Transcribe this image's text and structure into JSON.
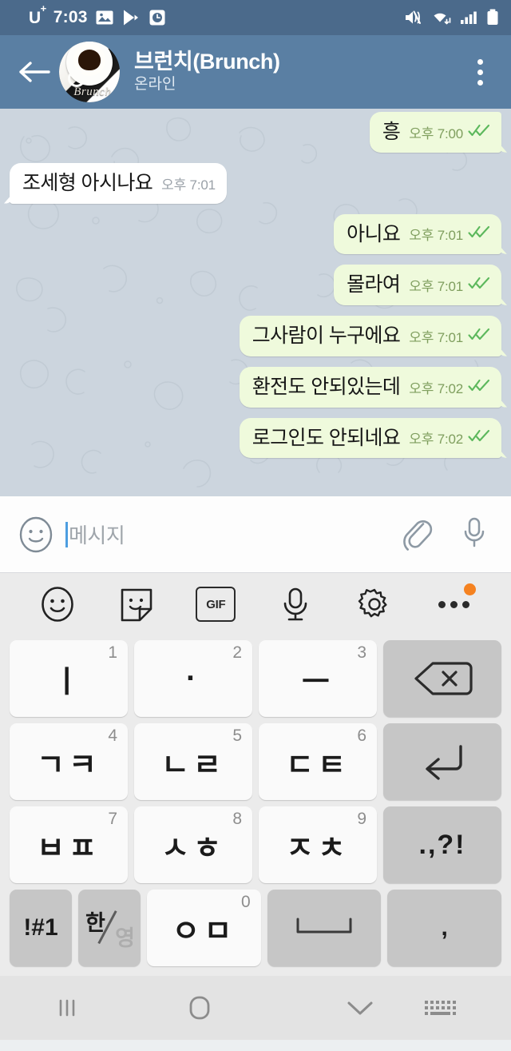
{
  "status_bar": {
    "carrier": "U",
    "carrier_sup": "+",
    "time": "7:03",
    "left_icons": [
      "gallery-icon",
      "play-store-icon",
      "clock-icon"
    ],
    "right_icons": [
      "mute-vibrate-icon",
      "wifi-icon",
      "signal-icon",
      "battery-icon"
    ]
  },
  "header": {
    "back_label": "back-arrow",
    "title": "브런치(Brunch)",
    "subtitle": "온라인",
    "avatar_text": "Brunch",
    "overflow_label": "more-options"
  },
  "chat": {
    "messages": [
      {
        "text": "흥",
        "time": "오후 7:00",
        "side": "out",
        "read": true
      },
      {
        "text": "조세형 아시나요",
        "time": "오후 7:01",
        "side": "in",
        "read": false
      },
      {
        "text": "아니요",
        "time": "오후 7:01",
        "side": "out",
        "read": true
      },
      {
        "text": "몰라여",
        "time": "오후 7:01",
        "side": "out",
        "read": true
      },
      {
        "text": "그사람이 누구에요",
        "time": "오후 7:01",
        "side": "out",
        "read": true
      },
      {
        "text": "환전도 안되있는데",
        "time": "오후 7:02",
        "side": "out",
        "read": true
      },
      {
        "text": "로그인도 안되네요",
        "time": "오후 7:02",
        "side": "out",
        "read": true
      }
    ]
  },
  "input_bar": {
    "emoji_icon": "smiley-icon",
    "placeholder": "메시지",
    "value": "",
    "attach_icon": "paperclip-icon",
    "mic_icon": "microphone-icon"
  },
  "keyboard_toolbar": {
    "items": [
      {
        "name": "emoji-icon",
        "label": ""
      },
      {
        "name": "sticker-icon",
        "label": ""
      },
      {
        "name": "gif-icon",
        "label": "GIF"
      },
      {
        "name": "voice-input-icon",
        "label": ""
      },
      {
        "name": "keyboard-settings-icon",
        "label": ""
      },
      {
        "name": "more-options-icon",
        "label": ""
      }
    ]
  },
  "keyboard": {
    "rows": [
      [
        {
          "label": "ㅣ",
          "num": "1",
          "type": "char",
          "name": "key-i"
        },
        {
          "label": "·",
          "num": "2",
          "type": "char",
          "name": "key-dot"
        },
        {
          "label": "ㅡ",
          "num": "3",
          "type": "char",
          "name": "key-eu"
        },
        {
          "label": "",
          "num": "",
          "type": "fn",
          "name": "backspace-key"
        }
      ],
      [
        {
          "label": "ㄱㅋ",
          "num": "4",
          "type": "char",
          "name": "key-giyeok-kieuk"
        },
        {
          "label": "ㄴㄹ",
          "num": "5",
          "type": "char",
          "name": "key-nieun-rieul"
        },
        {
          "label": "ㄷㅌ",
          "num": "6",
          "type": "char",
          "name": "key-digeut-tieut"
        },
        {
          "label": "",
          "num": "",
          "type": "fn",
          "name": "enter-key"
        }
      ],
      [
        {
          "label": "ㅂㅍ",
          "num": "7",
          "type": "char",
          "name": "key-bieup-pieup"
        },
        {
          "label": "ㅅㅎ",
          "num": "8",
          "type": "char",
          "name": "key-siot-hieut"
        },
        {
          "label": "ㅈㅊ",
          "num": "9",
          "type": "char",
          "name": "key-jieut-chieut"
        },
        {
          "label": ".,?!",
          "num": "",
          "type": "fn",
          "name": "punctuation-key"
        }
      ]
    ],
    "bottom_row": {
      "symbols_label": "!#1",
      "lang_ko": "한",
      "lang_en": "영",
      "zero_label": "ㅇㅁ",
      "zero_num": "0",
      "space_label": "",
      "comma_label": ","
    }
  },
  "nav_bar": {
    "recents": "recents-icon",
    "home": "home-icon",
    "dismiss": "dismiss-keyboard-icon",
    "keyboard": "keyboard-switch-icon"
  },
  "colors": {
    "status_bar": "#4b6a8b",
    "header": "#5a7fa3",
    "chat_bg": "#ccd5de",
    "bubble_out": "#effadc",
    "bubble_in": "#ffffff",
    "tick_green": "#5cb85c",
    "keyboard_bg": "#ebebeb",
    "key_fn": "#c6c6c6",
    "badge_orange": "#f58220"
  }
}
